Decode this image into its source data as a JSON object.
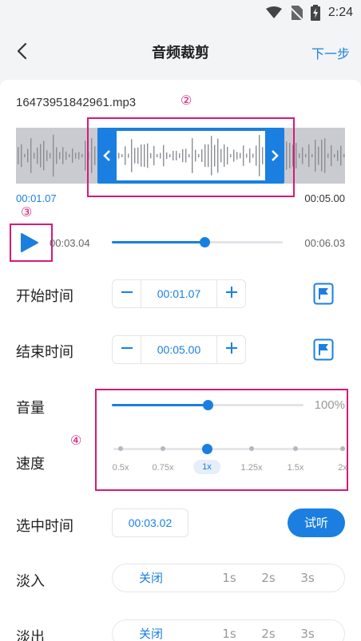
{
  "status_bar": {
    "time": "2:24"
  },
  "header": {
    "title": "音频裁剪",
    "next_label": "下一步"
  },
  "file": {
    "name": "16473951842961.mp3"
  },
  "waveform": {
    "selection_start": "00:01.07",
    "selection_end": "00:05.00"
  },
  "playback": {
    "current": "00:03.04",
    "total": "00:06.03",
    "progress": 0.54
  },
  "start_time": {
    "label": "开始时间",
    "value": "00:01.07"
  },
  "end_time": {
    "label": "结束时间",
    "value": "00:05.00"
  },
  "volume": {
    "label": "音量",
    "value": "100%",
    "level": 0.5
  },
  "speed": {
    "label": "速度",
    "options": [
      "0.5x",
      "0.75x",
      "1x",
      "1.25x",
      "1.5x",
      "2x"
    ],
    "selected": "1x"
  },
  "selected_time": {
    "label": "选中时间",
    "value": "00:03.02",
    "preview_label": "试听"
  },
  "fade_in": {
    "label": "淡入",
    "options": [
      "关闭",
      "1s",
      "2s",
      "3s"
    ],
    "selected": "关闭"
  },
  "fade_out": {
    "label": "淡出",
    "options": [
      "关闭",
      "1s",
      "2s",
      "3s"
    ],
    "selected": "关闭"
  },
  "annotations": {
    "a2": "②",
    "a3": "③",
    "a4": "④"
  },
  "colors": {
    "accent": "#1a7fe0",
    "annotation": "#d6197a"
  },
  "icons": {
    "back": "chevron-left-icon",
    "play": "play-icon",
    "flag": "flag-icon",
    "minus": "minus-icon",
    "plus": "plus-icon"
  }
}
